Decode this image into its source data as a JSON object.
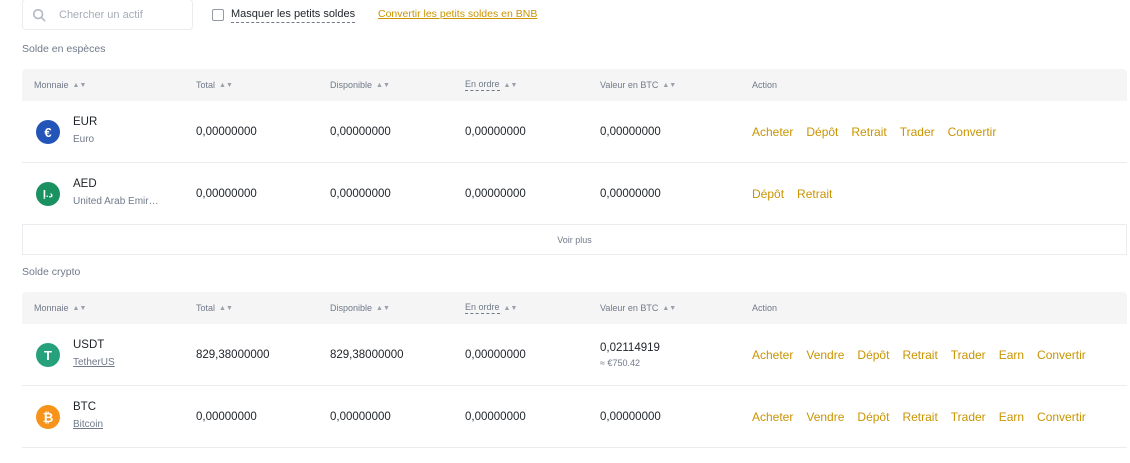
{
  "toolbar": {
    "search_placeholder": "Chercher un actif",
    "hide_small_label": "Masquer les petits soldes",
    "convert_link": "Convertir les petits soldes en BNB"
  },
  "columns": {
    "coin": "Monnaie",
    "total": "Total",
    "available": "Disponible",
    "in_order": "En ordre",
    "btc_value": "Valeur en BTC",
    "action": "Action"
  },
  "fiat": {
    "title": "Solde en espèces",
    "see_more": "Voir plus",
    "rows": [
      {
        "symbol": "EUR",
        "name": "Euro",
        "icon": "euro-icon",
        "icon_color": "#2354b8",
        "icon_glyph": "€",
        "total": "0,00000000",
        "available": "0,00000000",
        "in_order": "0,00000000",
        "btc": "0,00000000",
        "actions": [
          "Acheter",
          "Dépôt",
          "Retrait",
          "Trader",
          "Convertir"
        ]
      },
      {
        "symbol": "AED",
        "name": "United Arab Emir…",
        "icon": "dirham-icon",
        "icon_color": "#1a9160",
        "icon_glyph": "د.إ",
        "total": "0,00000000",
        "available": "0,00000000",
        "in_order": "0,00000000",
        "btc": "0,00000000",
        "actions": [
          "Dépôt",
          "Retrait"
        ]
      }
    ]
  },
  "crypto": {
    "title": "Solde crypto",
    "rows": [
      {
        "symbol": "USDT",
        "name": "TetherUS",
        "icon": "tether-icon",
        "icon_color": "#26a17b",
        "icon_glyph": "T",
        "total": "829,38000000",
        "available": "829,38000000",
        "in_order": "0,00000000",
        "btc": "0,02114919",
        "btc_fiat": "≈ €750.42",
        "actions": [
          "Acheter",
          "Vendre",
          "Dépôt",
          "Retrait",
          "Trader",
          "Earn",
          "Convertir"
        ]
      },
      {
        "symbol": "BTC",
        "name": "Bitcoin",
        "icon": "bitcoin-icon",
        "icon_color": "#f7931a",
        "icon_glyph": "₿",
        "total": "0,00000000",
        "available": "0,00000000",
        "in_order": "0,00000000",
        "btc": "0,00000000",
        "actions": [
          "Acheter",
          "Vendre",
          "Dépôt",
          "Retrait",
          "Trader",
          "Earn",
          "Convertir"
        ]
      }
    ]
  }
}
